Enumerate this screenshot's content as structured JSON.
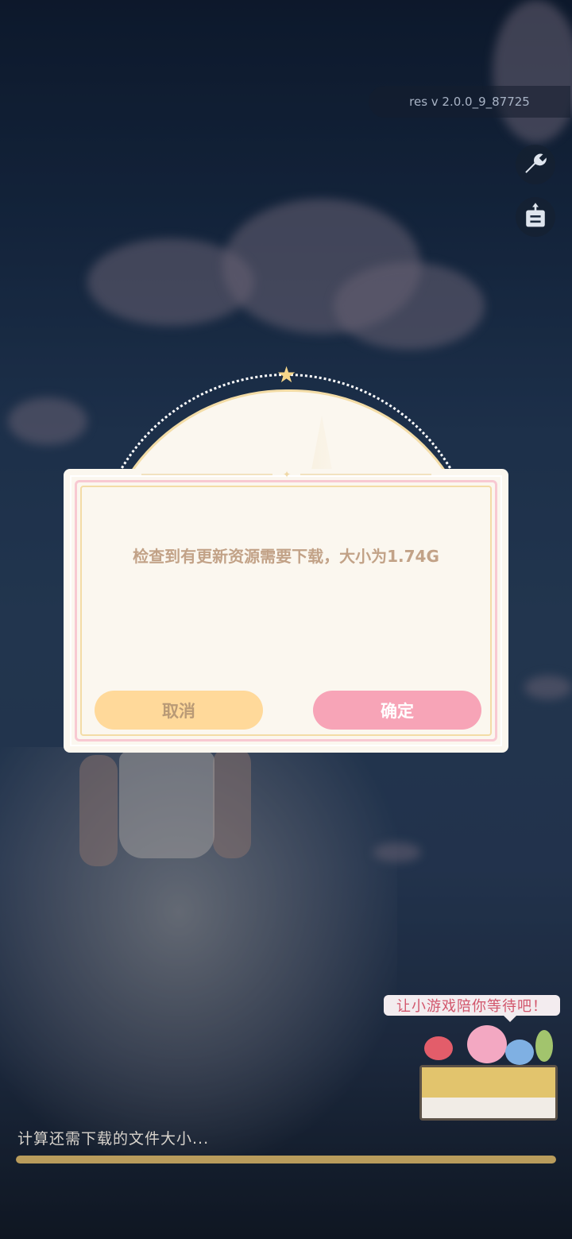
{
  "version_label": "res v 2.0.0_9_87725",
  "toolbar": {
    "tools_icon": "wrench-icon",
    "notice_icon": "notice-board-icon"
  },
  "dialog": {
    "message": "检查到有更新资源需要下载，大小为1.74G",
    "cancel_label": "取消",
    "confirm_label": "确定"
  },
  "minigame": {
    "prompt": "让小游戏陪你等待吧！"
  },
  "loading": {
    "status_text": "计算还需下载的文件大小...",
    "progress": 1.0
  },
  "colors": {
    "dialog_bg": "#fbf7ef",
    "cancel_button": "#ffd99a",
    "confirm_button": "#f7a4b7",
    "progress_fill": "#b99c5c"
  }
}
